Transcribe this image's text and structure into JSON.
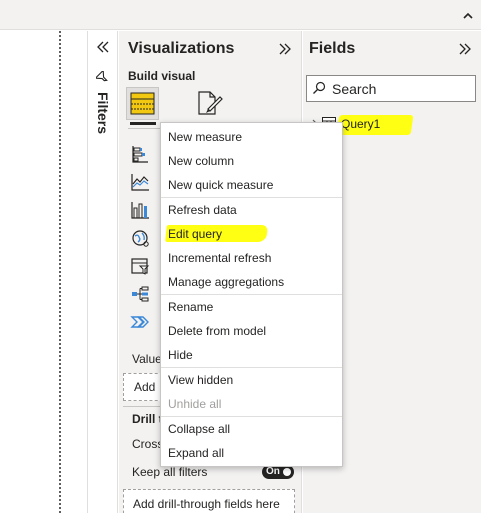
{
  "filters": {
    "label": "Filters"
  },
  "visualizations": {
    "title": "Visualizations",
    "build_visual": "Build visual",
    "values_label": "Value",
    "add_data_label": "Add",
    "drill_label": "Drill t",
    "cross_label": "Cross",
    "keep_filters_label": "Keep all filters",
    "keep_filters_toggle": "On",
    "drill_drop_label": "Add drill-through fields here"
  },
  "fields": {
    "title": "Fields",
    "search_placeholder": "Search",
    "table_name": "Query1"
  },
  "context_menu": {
    "items": [
      "New measure",
      "New column",
      "New quick measure",
      "Refresh data",
      "Edit query",
      "Incremental refresh",
      "Manage aggregations",
      "Rename",
      "Delete from model",
      "Hide",
      "View hidden",
      "Unhide all",
      "Collapse all",
      "Expand all"
    ]
  },
  "colors": {
    "highlight": "#ffff14",
    "pane_bg": "#f3f2f1",
    "text": "#252423",
    "disabled_text": "#a19f9d"
  },
  "icons": {
    "ribbon": "chevron-up-icon",
    "filters_expand": "double-chevron-left-icon",
    "filters": "funnel-icon",
    "viz_collapse": "double-chevron-right-icon",
    "fields_collapse": "double-chevron-right-icon",
    "build_visual": "table-visual-icon",
    "format_visual": "paintbrush-page-icon",
    "search": "search-icon",
    "table": "table-icon"
  }
}
